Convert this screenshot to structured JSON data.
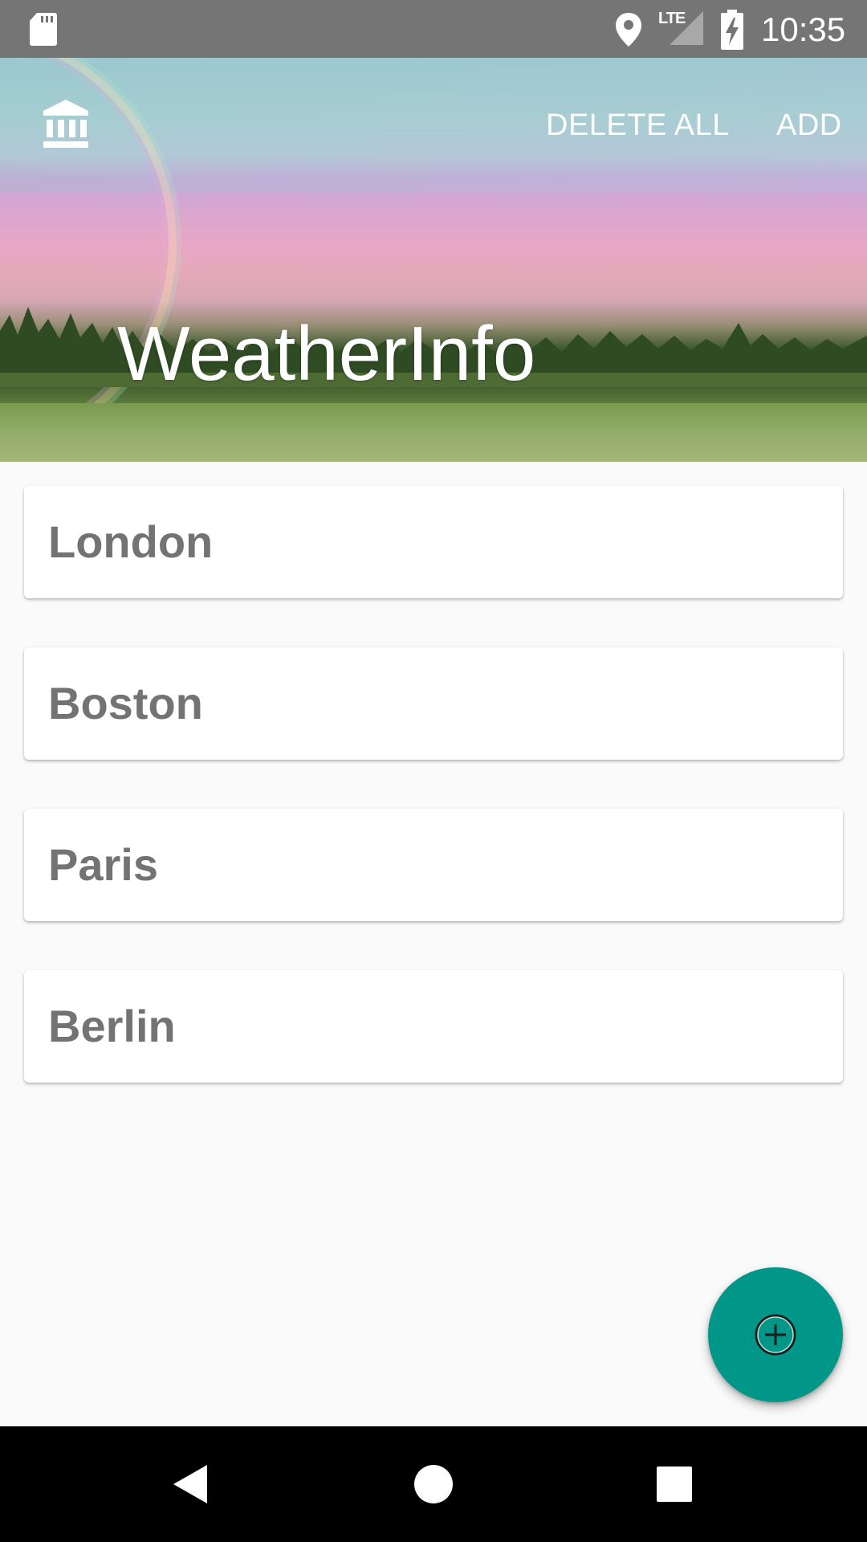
{
  "status_bar": {
    "time": "10:35",
    "network": "LTE",
    "icons": [
      "sd-card-icon",
      "location-icon",
      "lte-signal-icon",
      "battery-charging-icon"
    ]
  },
  "toolbar": {
    "nav_icon": "bank-icon",
    "delete_all_label": "DELETE ALL",
    "add_label": "ADD"
  },
  "header": {
    "title": "WeatherInfo"
  },
  "cities": [
    {
      "name": "London"
    },
    {
      "name": "Boston"
    },
    {
      "name": "Paris"
    },
    {
      "name": "Berlin"
    }
  ],
  "fab": {
    "icon": "add-circle-icon",
    "color": "#009688"
  },
  "nav_bar": {
    "icons": [
      "back-icon",
      "home-icon",
      "recents-icon"
    ]
  },
  "colors": {
    "status_bar": "#757575",
    "background": "#fafafa",
    "card": "#ffffff",
    "city_text": "#737373",
    "accent": "#009688",
    "nav_bar": "#000000"
  }
}
